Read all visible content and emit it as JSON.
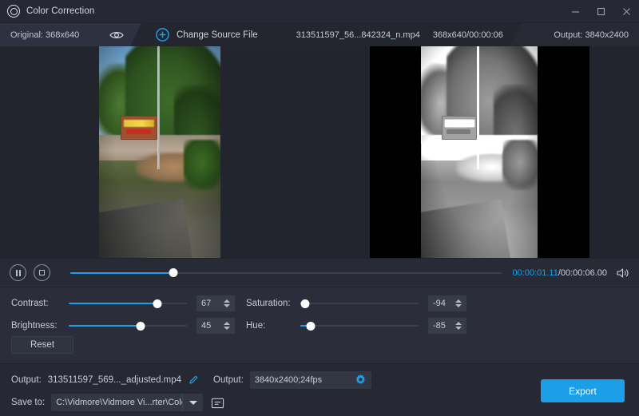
{
  "window": {
    "title": "Color Correction",
    "app_icon": "color-correction-icon",
    "minimize": "—",
    "maximize": "☐",
    "close": "✕"
  },
  "sourcebar": {
    "original_label": "Original: 368x640",
    "eye_icon": "eye-icon",
    "add_icon": "plus-circle-icon",
    "change_source_label": "Change Source File",
    "filename": "313511597_56...842324_n.mp4",
    "dimensions_duration": "368x640/00:00:06",
    "output_label": "Output: 3840x2400"
  },
  "preview": {
    "left_title": "original-video-preview",
    "right_title": "output-video-preview"
  },
  "playback": {
    "pause_icon": "pause-icon",
    "stop_icon": "stop-icon",
    "progress_percent": 24,
    "current_time": "00:00:01.11",
    "total_time": "/00:00:06.00",
    "volume_icon": "speaker-icon"
  },
  "adjust": {
    "contrast": {
      "label": "Contrast:",
      "value": "67",
      "knob_percent": 75
    },
    "brightness": {
      "label": "Brightness:",
      "value": "45",
      "knob_percent": 61
    },
    "saturation": {
      "label": "Saturation:",
      "value": "-94",
      "knob_percent": 4
    },
    "hue": {
      "label": "Hue:",
      "value": "-85",
      "knob_percent": 9
    },
    "reset_label": "Reset"
  },
  "bottom": {
    "output_label": "Output:",
    "output_filename": "313511597_569..._adjusted.mp4",
    "edit_icon": "pencil-icon",
    "format_label": "Output:",
    "format_value": "3840x2400;24fps",
    "settings_icon": "gear-icon",
    "save_to_label": "Save to:",
    "save_path": "C:\\Vidmore\\Vidmore Vi...rter\\Color Correction",
    "dropdown_icon": "chevron-down-icon",
    "folder_icon": "folder-icon",
    "export_label": "Export"
  },
  "colors": {
    "accent": "#1d9fe8",
    "window_bg": "#2b2e3a",
    "titlebar_bg": "#262934",
    "stage_bg": "#22252e",
    "text": "#c6cbd4"
  }
}
